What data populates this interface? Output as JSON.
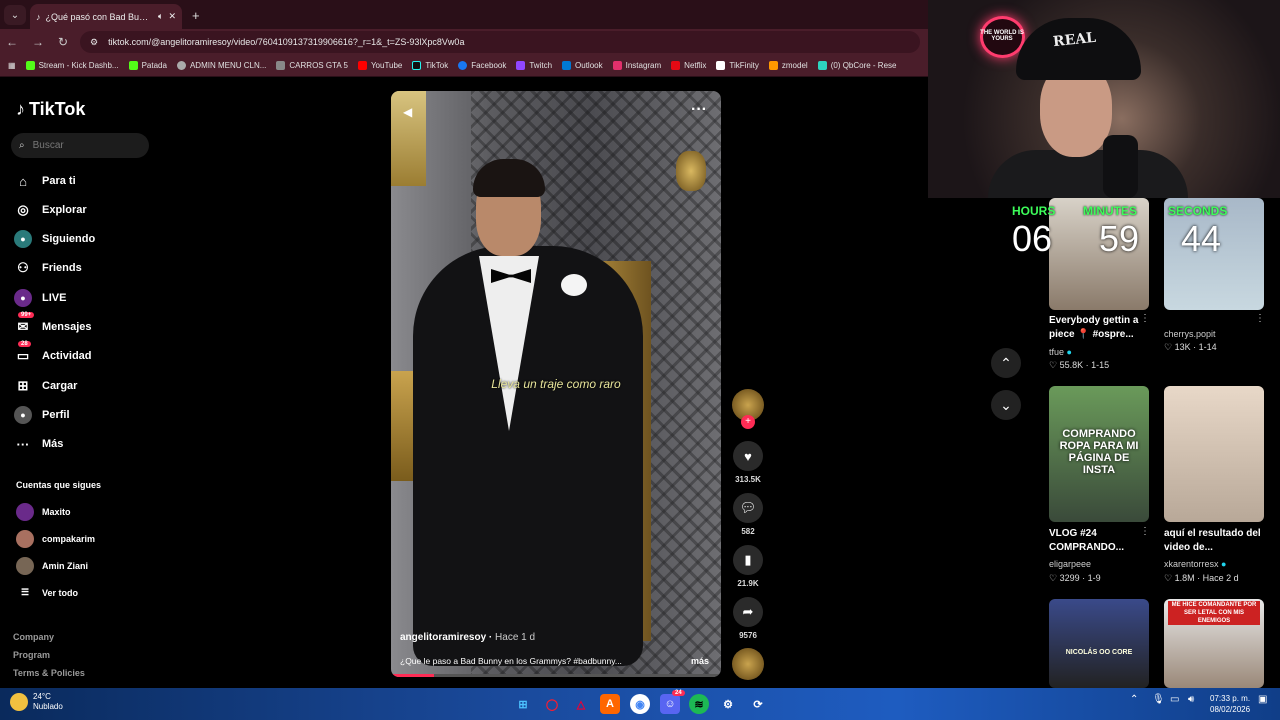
{
  "browser": {
    "tab_title": "¿Qué pasó con Bad Bunny e",
    "url": "tiktok.com/@angelitoramiresoy/video/7604109137319906616?_r=1&_t=ZS-93lXpc8Vw0a",
    "bookmarks": [
      "Stream - Kick Dashb...",
      "Patada",
      "ADMIN MENU CLN...",
      "CARROS GTA 5",
      "YouTube",
      "TikTok",
      "Facebook",
      "Twitch",
      "Outlook",
      "Instagram",
      "Netflix",
      "TikFinity",
      "zmodel",
      "(0) QbCore - Rese"
    ]
  },
  "sidebar": {
    "logo": "TikTok",
    "search_placeholder": "Buscar",
    "nav": [
      {
        "label": "Para ti",
        "icon": "home-icon"
      },
      {
        "label": "Explorar",
        "icon": "compass-icon"
      },
      {
        "label": "Siguiendo",
        "icon": "following-icon"
      },
      {
        "label": "Friends",
        "icon": "friends-icon"
      },
      {
        "label": "LIVE",
        "icon": "live-icon"
      },
      {
        "label": "Mensajes",
        "icon": "messages-icon",
        "badge": "99+"
      },
      {
        "label": "Actividad",
        "icon": "activity-icon",
        "badge": "28"
      },
      {
        "label": "Cargar",
        "icon": "upload-icon"
      },
      {
        "label": "Perfil",
        "icon": "profile-icon"
      },
      {
        "label": "Más",
        "icon": "more-icon"
      }
    ],
    "following_title": "Cuentas que sigues",
    "following": [
      "Maxito",
      "compakarim",
      "Amin Ziani"
    ],
    "see_all": "Ver todo",
    "footer": [
      "Company",
      "Program",
      "Terms & Policies"
    ]
  },
  "video": {
    "caption_overlay": "Lleva un traje como raro",
    "author": "angelitoramiresoy",
    "ago": "Hace 1 d",
    "description": "¿Que le paso a Bad Bunny en los Grammys? #badbunny...",
    "more": "más",
    "progress": 0.13,
    "likes": "313.5K",
    "comments": "582",
    "saves": "21.9K",
    "shares": "9576"
  },
  "timer": {
    "hours_label": "HOURS",
    "hours": "06",
    "minutes_label": "MINUTES",
    "minutes": "59",
    "seconds_label": "SECONDS",
    "seconds": "44"
  },
  "webcam": {
    "cap_text": "REAL",
    "neon_sign": "THE WORLD IS YOURS"
  },
  "feed": [
    {
      "title": "Everybody gettin a piece 📍 #ospre...",
      "author": "tfue",
      "likes": "55.8K",
      "date": "1-15"
    },
    {
      "title": "",
      "author": "cherrys.popit",
      "likes": "13K",
      "date": "1-14"
    },
    {
      "title": "VLOG #24 COMPRANDO...",
      "author": "eligarpeee",
      "likes": "3299",
      "date": "1-9",
      "thumb_text": "COMPRANDO ROPA PARA MI PÁGINA DE INSTA"
    },
    {
      "title": "aquí el resultado del video de...",
      "author": "xkarentorresx",
      "likes": "1.8M",
      "date": "Hace 2 d"
    },
    {
      "title": "",
      "author": "",
      "thumb_text": "NICOLÁS OO CORE"
    },
    {
      "title": "",
      "author": "",
      "thumb_text": "ME HICE COMANDANTE POR SER LETAL CON MIS ENEMIGOS"
    }
  ],
  "taskbar": {
    "temp": "24°C",
    "weather": "Nublado",
    "time": "07:33 p. m.",
    "date": "08/02/2026",
    "discord_badge": "24"
  }
}
